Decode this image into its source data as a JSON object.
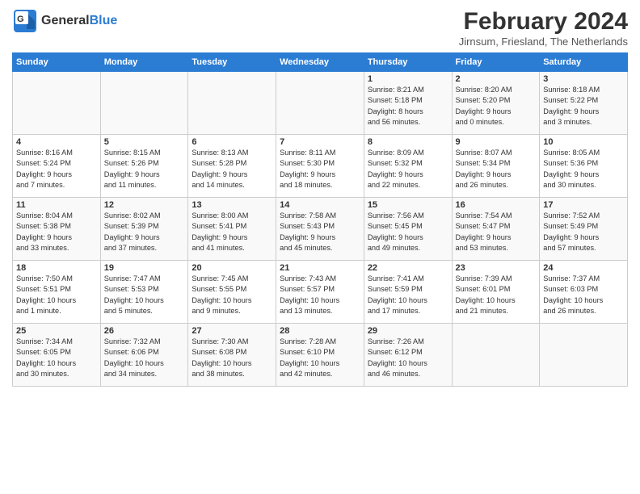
{
  "header": {
    "logo_general": "General",
    "logo_blue": "Blue",
    "month_title": "February 2024",
    "subtitle": "Jirnsum, Friesland, The Netherlands"
  },
  "days_of_week": [
    "Sunday",
    "Monday",
    "Tuesday",
    "Wednesday",
    "Thursday",
    "Friday",
    "Saturday"
  ],
  "weeks": [
    [
      {
        "day": "",
        "info": ""
      },
      {
        "day": "",
        "info": ""
      },
      {
        "day": "",
        "info": ""
      },
      {
        "day": "",
        "info": ""
      },
      {
        "day": "1",
        "info": "Sunrise: 8:21 AM\nSunset: 5:18 PM\nDaylight: 8 hours\nand 56 minutes."
      },
      {
        "day": "2",
        "info": "Sunrise: 8:20 AM\nSunset: 5:20 PM\nDaylight: 9 hours\nand 0 minutes."
      },
      {
        "day": "3",
        "info": "Sunrise: 8:18 AM\nSunset: 5:22 PM\nDaylight: 9 hours\nand 3 minutes."
      }
    ],
    [
      {
        "day": "4",
        "info": "Sunrise: 8:16 AM\nSunset: 5:24 PM\nDaylight: 9 hours\nand 7 minutes."
      },
      {
        "day": "5",
        "info": "Sunrise: 8:15 AM\nSunset: 5:26 PM\nDaylight: 9 hours\nand 11 minutes."
      },
      {
        "day": "6",
        "info": "Sunrise: 8:13 AM\nSunset: 5:28 PM\nDaylight: 9 hours\nand 14 minutes."
      },
      {
        "day": "7",
        "info": "Sunrise: 8:11 AM\nSunset: 5:30 PM\nDaylight: 9 hours\nand 18 minutes."
      },
      {
        "day": "8",
        "info": "Sunrise: 8:09 AM\nSunset: 5:32 PM\nDaylight: 9 hours\nand 22 minutes."
      },
      {
        "day": "9",
        "info": "Sunrise: 8:07 AM\nSunset: 5:34 PM\nDaylight: 9 hours\nand 26 minutes."
      },
      {
        "day": "10",
        "info": "Sunrise: 8:05 AM\nSunset: 5:36 PM\nDaylight: 9 hours\nand 30 minutes."
      }
    ],
    [
      {
        "day": "11",
        "info": "Sunrise: 8:04 AM\nSunset: 5:38 PM\nDaylight: 9 hours\nand 33 minutes."
      },
      {
        "day": "12",
        "info": "Sunrise: 8:02 AM\nSunset: 5:39 PM\nDaylight: 9 hours\nand 37 minutes."
      },
      {
        "day": "13",
        "info": "Sunrise: 8:00 AM\nSunset: 5:41 PM\nDaylight: 9 hours\nand 41 minutes."
      },
      {
        "day": "14",
        "info": "Sunrise: 7:58 AM\nSunset: 5:43 PM\nDaylight: 9 hours\nand 45 minutes."
      },
      {
        "day": "15",
        "info": "Sunrise: 7:56 AM\nSunset: 5:45 PM\nDaylight: 9 hours\nand 49 minutes."
      },
      {
        "day": "16",
        "info": "Sunrise: 7:54 AM\nSunset: 5:47 PM\nDaylight: 9 hours\nand 53 minutes."
      },
      {
        "day": "17",
        "info": "Sunrise: 7:52 AM\nSunset: 5:49 PM\nDaylight: 9 hours\nand 57 minutes."
      }
    ],
    [
      {
        "day": "18",
        "info": "Sunrise: 7:50 AM\nSunset: 5:51 PM\nDaylight: 10 hours\nand 1 minute."
      },
      {
        "day": "19",
        "info": "Sunrise: 7:47 AM\nSunset: 5:53 PM\nDaylight: 10 hours\nand 5 minutes."
      },
      {
        "day": "20",
        "info": "Sunrise: 7:45 AM\nSunset: 5:55 PM\nDaylight: 10 hours\nand 9 minutes."
      },
      {
        "day": "21",
        "info": "Sunrise: 7:43 AM\nSunset: 5:57 PM\nDaylight: 10 hours\nand 13 minutes."
      },
      {
        "day": "22",
        "info": "Sunrise: 7:41 AM\nSunset: 5:59 PM\nDaylight: 10 hours\nand 17 minutes."
      },
      {
        "day": "23",
        "info": "Sunrise: 7:39 AM\nSunset: 6:01 PM\nDaylight: 10 hours\nand 21 minutes."
      },
      {
        "day": "24",
        "info": "Sunrise: 7:37 AM\nSunset: 6:03 PM\nDaylight: 10 hours\nand 26 minutes."
      }
    ],
    [
      {
        "day": "25",
        "info": "Sunrise: 7:34 AM\nSunset: 6:05 PM\nDaylight: 10 hours\nand 30 minutes."
      },
      {
        "day": "26",
        "info": "Sunrise: 7:32 AM\nSunset: 6:06 PM\nDaylight: 10 hours\nand 34 minutes."
      },
      {
        "day": "27",
        "info": "Sunrise: 7:30 AM\nSunset: 6:08 PM\nDaylight: 10 hours\nand 38 minutes."
      },
      {
        "day": "28",
        "info": "Sunrise: 7:28 AM\nSunset: 6:10 PM\nDaylight: 10 hours\nand 42 minutes."
      },
      {
        "day": "29",
        "info": "Sunrise: 7:26 AM\nSunset: 6:12 PM\nDaylight: 10 hours\nand 46 minutes."
      },
      {
        "day": "",
        "info": ""
      },
      {
        "day": "",
        "info": ""
      }
    ]
  ]
}
